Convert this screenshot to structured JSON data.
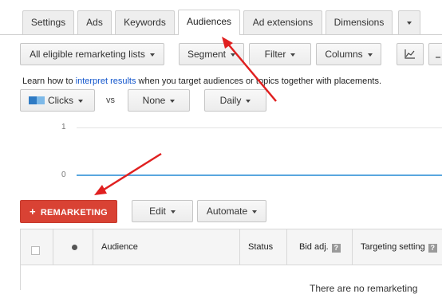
{
  "tabs": [
    {
      "label": "Settings"
    },
    {
      "label": "Ads"
    },
    {
      "label": "Keywords"
    },
    {
      "label": "Audiences"
    },
    {
      "label": "Ad extensions"
    },
    {
      "label": "Dimensions"
    }
  ],
  "toolbar": {
    "list_filter": "All eligible remarketing lists",
    "segment": "Segment",
    "filter": "Filter",
    "columns": "Columns"
  },
  "info": {
    "prefix": "Learn how to ",
    "link": "interpret results",
    "suffix": " when you target audiences or topics together with placements."
  },
  "chart_controls": {
    "metric1": "Clicks",
    "vs": "vs",
    "metric2": "None",
    "period": "Daily",
    "metric1_color_a": "#2f7bc4",
    "metric1_color_b": "#7db9e8"
  },
  "chart": {
    "tick_top": "1",
    "tick_bottom": "0",
    "line_color": "#5aa7df"
  },
  "actions": {
    "remarketing": "REMARKETING",
    "edit": "Edit",
    "automate": "Automate"
  },
  "table": {
    "col_audience": "Audience",
    "col_status": "Status",
    "col_bid": "Bid adj.",
    "col_targeting": "Targeting setting",
    "empty_text": "There are no remarketing"
  },
  "colors": {
    "accent_red": "#d94234",
    "arrow_red": "#e02020"
  }
}
